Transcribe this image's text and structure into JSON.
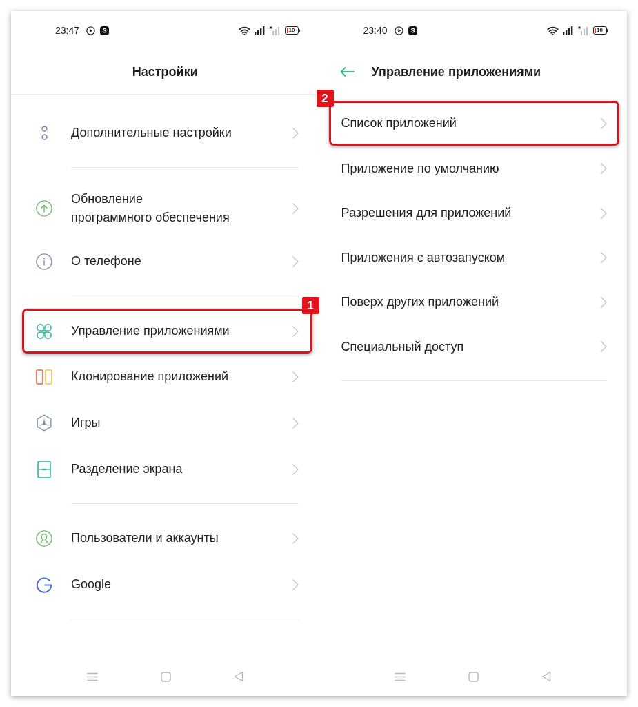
{
  "screens": [
    {
      "status_bar": {
        "time": "23:47",
        "battery": "10"
      },
      "header": {
        "title": "Настройки",
        "back_button": false,
        "separator": true
      },
      "groups": [
        {
          "items": [
            {
              "label": "Дополнительные настройки"
            }
          ]
        },
        {
          "items": [
            {
              "label": "Обновление\nпрограммного обеспечения"
            },
            {
              "label": "О телефоне"
            }
          ]
        },
        {
          "items": [
            {
              "label": "Управление приложениями",
              "callout": "1"
            },
            {
              "label": "Клонирование приложений"
            },
            {
              "label": "Игры"
            },
            {
              "label": "Разделение экрана"
            }
          ]
        },
        {
          "items": [
            {
              "label": "Пользователи и аккаунты"
            },
            {
              "label": "Google"
            }
          ]
        }
      ]
    },
    {
      "status_bar": {
        "time": "23:40",
        "battery": "10"
      },
      "header": {
        "title": "Управление приложениями",
        "back_button": true,
        "separator": false
      },
      "groups": [
        {
          "items": [
            {
              "label": "Список приложений",
              "callout": "2"
            },
            {
              "label": "Приложение по умолчанию"
            },
            {
              "label": "Разрешения для приложений"
            },
            {
              "label": "Приложения с автозапуском"
            },
            {
              "label": "Поверх других приложений"
            },
            {
              "label": "Специальный доступ"
            }
          ]
        }
      ]
    }
  ]
}
